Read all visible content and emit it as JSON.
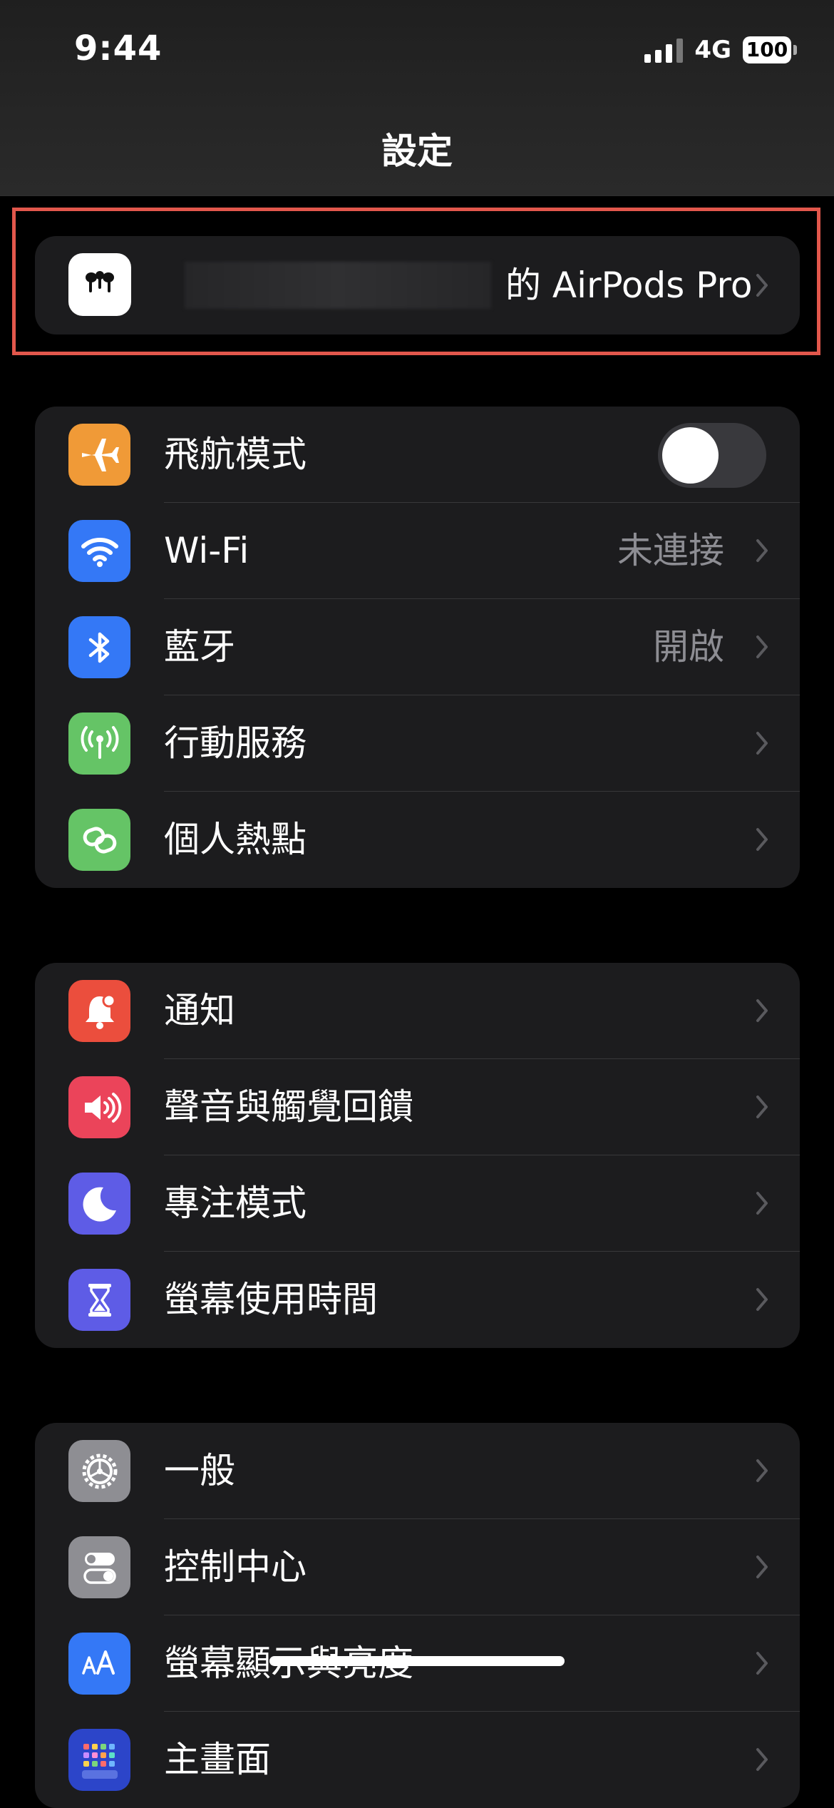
{
  "status_bar": {
    "time": "9:44",
    "network": "4G",
    "battery": "100"
  },
  "nav": {
    "title": "設定"
  },
  "airpods": {
    "label": "的 AirPods Pro",
    "icon": "airpods-icon"
  },
  "group_connectivity": [
    {
      "label": "飛航模式",
      "icon": "airplane-icon",
      "color": "#f09a37",
      "toggle": false
    },
    {
      "label": "Wi-Fi",
      "value": "未連接",
      "icon": "wifi-icon",
      "color": "#3478f6"
    },
    {
      "label": "藍牙",
      "value": "開啟",
      "icon": "bluetooth-icon",
      "color": "#3478f6"
    },
    {
      "label": "行動服務",
      "icon": "antenna-icon",
      "color": "#65c466"
    },
    {
      "label": "個人熱點",
      "icon": "hotspot-icon",
      "color": "#65c466"
    }
  ],
  "group_notifications": [
    {
      "label": "通知",
      "icon": "notification-icon",
      "color": "#eb4e3d"
    },
    {
      "label": "聲音與觸覺回饋",
      "icon": "sound-icon",
      "color": "#eb445a"
    },
    {
      "label": "專注模式",
      "icon": "moon-icon",
      "color": "#5e5ce6"
    },
    {
      "label": "螢幕使用時間",
      "icon": "hourglass-icon",
      "color": "#5e5ce6"
    }
  ],
  "group_general": [
    {
      "label": "一般",
      "icon": "gear-icon",
      "color": "#8e8e93"
    },
    {
      "label": "控制中心",
      "icon": "switches-icon",
      "color": "#8e8e93"
    },
    {
      "label": "螢幕顯示與亮度",
      "icon": "text-size-icon",
      "color": "#3478f6"
    },
    {
      "label": "主畫面",
      "icon": "home-screen-icon",
      "color": "#2c45c9"
    }
  ]
}
